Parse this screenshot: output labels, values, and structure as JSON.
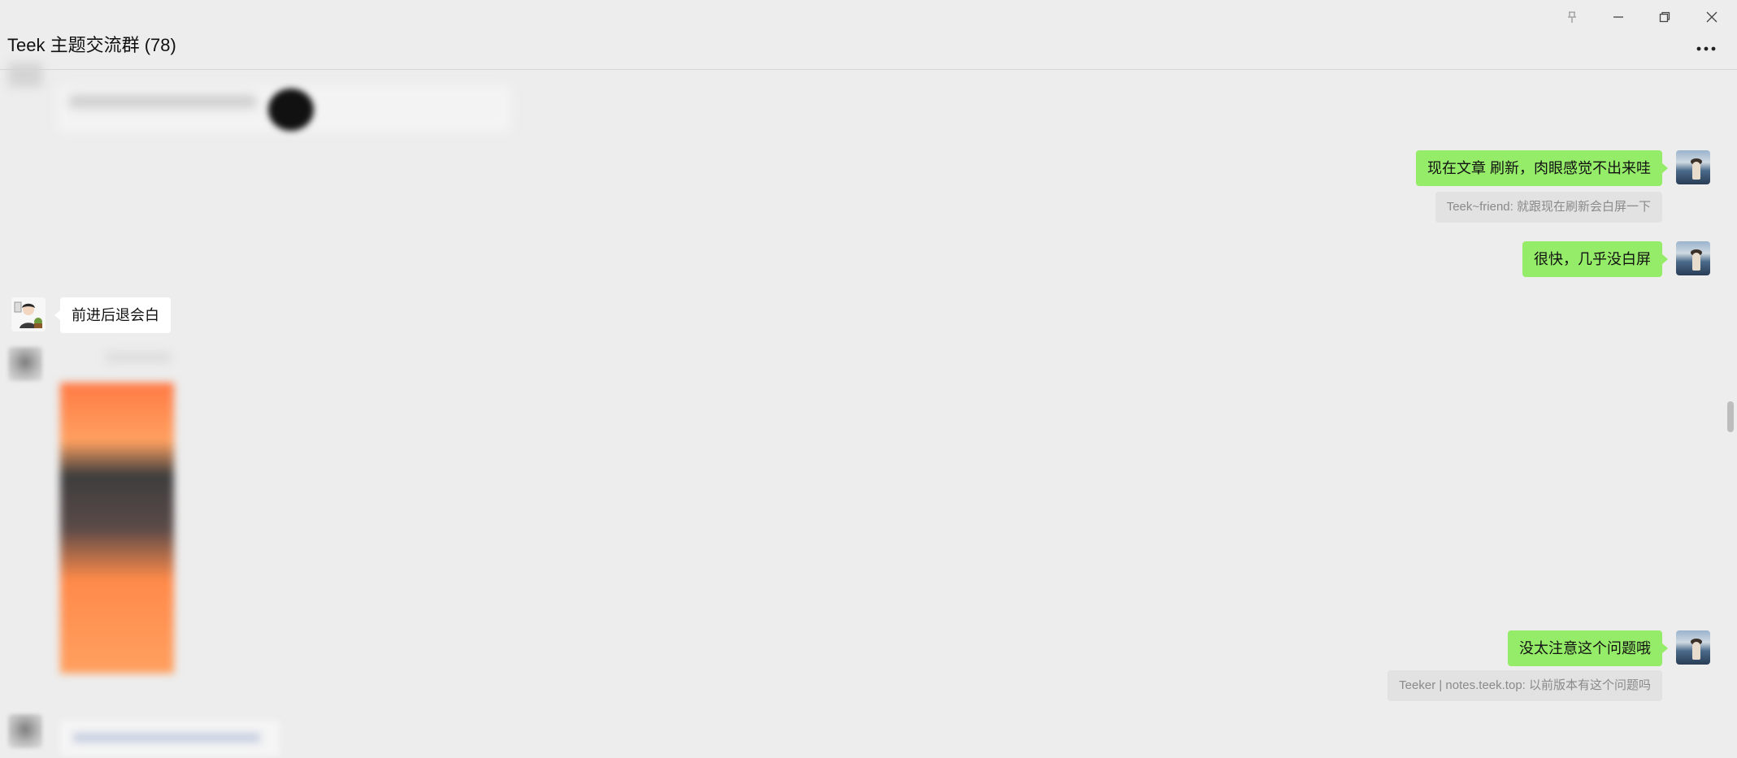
{
  "window": {
    "title": "Teek 主题交流群 (78)",
    "controls": [
      {
        "name": "pin-icon"
      },
      {
        "name": "minimize-icon"
      },
      {
        "name": "restore-icon"
      },
      {
        "name": "close-icon"
      }
    ],
    "more_icon": "more-dots-icon"
  },
  "messages": [
    {
      "side": "right",
      "text": "现在文章 刷新，肉眼感觉不出来哇",
      "quote": "Teek~friend: 就跟现在刷新会白屏一下"
    },
    {
      "side": "right",
      "text": "很快，几乎没白屏"
    },
    {
      "side": "left",
      "text": "前进后退会白"
    },
    {
      "side": "right",
      "text": "没太注意这个问题哦",
      "quote": "Teeker | notes.teek.top: 以前版本有这个问题吗"
    }
  ],
  "colors": {
    "background": "#ededed",
    "my_bubble": "#95ec69",
    "other_bubble": "#ffffff",
    "quote_bg": "#e2e2e2"
  }
}
